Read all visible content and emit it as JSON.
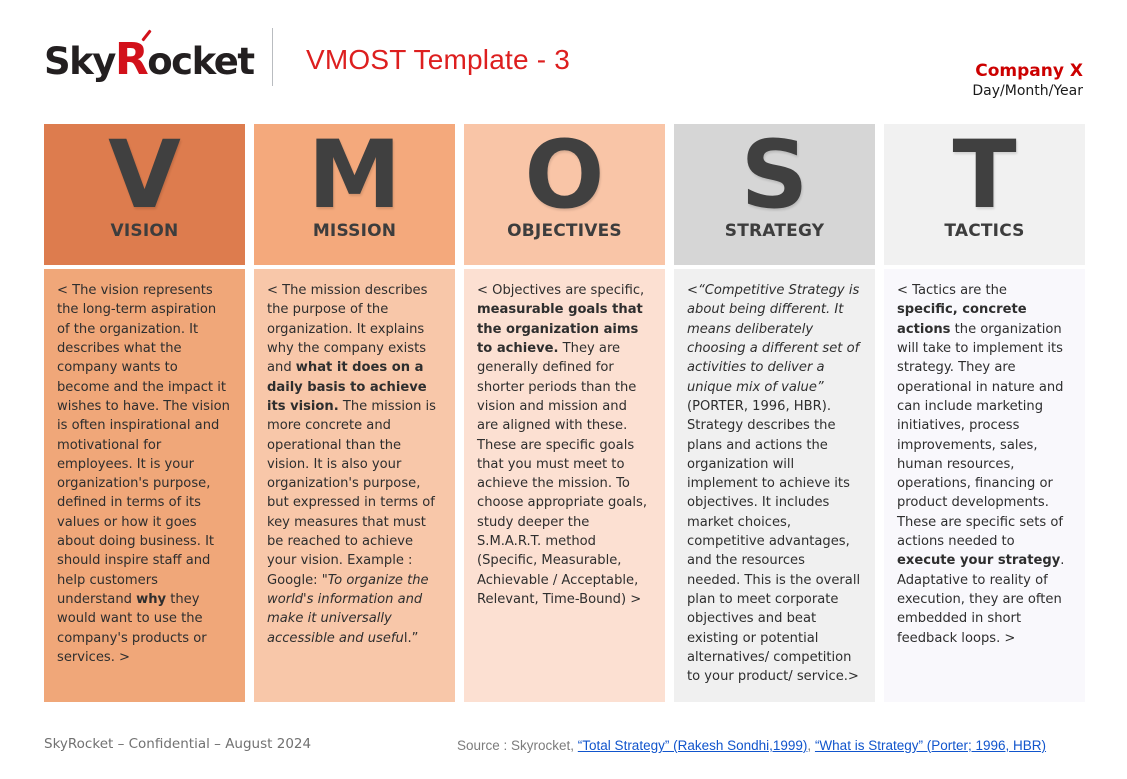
{
  "header": {
    "logo": {
      "part1": "Sky",
      "accent_letter": "R",
      "part2": "ocket",
      "icon": "accent-mark-icon"
    },
    "title": "VMOST Template - 3",
    "company": "Company X",
    "date": "Day/Month/Year",
    "brand_red": "#d2111b",
    "title_red": "#dd1f1f",
    "company_red": "#cc0000"
  },
  "columns": [
    {
      "letter": "V",
      "name": "VISION",
      "head_bg": "#dd7c4e",
      "body_bg": "#f0a779",
      "body_html": "&lt; The vision represents the long-term aspiration of the organization. It describes what the company wants to become and the impact it wishes to have. The vision is often inspirational and motivational for employees. It is your organization's purpose, defined in terms of its values or how it goes about doing business. It should inspire staff and help customers understand <b>why</b> they would want to use the company's products or services. &gt;",
      "body_text": "< The vision represents the long-term aspiration of the organization. It describes what the company wants to become and the impact it wishes to have. The vision is often inspirational and motivational for employees. It is your organization's purpose, defined in terms of its values or how it goes about doing business. It should inspire staff and help customers understand why they would want to use the company's products or services. >"
    },
    {
      "letter": "M",
      "name": "MISSION",
      "head_bg": "#f4a97c",
      "body_bg": "#f8c7a9",
      "body_html": "&lt; The mission describes the purpose of the organization. It explains why the company exists and <b>what it does on a daily basis to achieve its vision.</b> The mission is more concrete and operational than the vision. It is also your organization's purpose, but expressed in terms of key measures that must be reached to achieve your vision. Example : Google: \"<i>To organize the world's information and make it universally accessible and usefu</i>l.”",
      "body_text": "< The mission describes the purpose of the organization. It explains why the company exists and what it does on a daily basis to achieve its vision. The mission is more concrete and operational than the vision. It is also your organization's purpose, but expressed in terms of key measures that must be reached to achieve your vision. Example : Google: \"To organize the world's information and make it universally accessible and useful.”"
    },
    {
      "letter": "O",
      "name": "OBJECTIVES",
      "head_bg": "#f9c5a7",
      "body_bg": "#fce0d2",
      "body_html": "&lt; Objectives are specific, <b>measurable goals that the organization aims to achieve.</b> They are generally defined for shorter periods than the vision and mission and are aligned with these. These are specific goals that you must meet to achieve the mission. To choose appropriate goals, study deeper the S.M.A.R.T. method (Specific, Measurable, Achievable / Acceptable, Relevant, Time-Bound) &gt;",
      "body_text": "< Objectives are specific, measurable goals that the organization aims to achieve. They are generally defined for shorter periods than the vision and mission and are aligned with these. These are specific goals that you must meet to achieve the mission. To choose appropriate goals, study deeper the S.M.A.R.T. method (Specific, Measurable, Achievable / Acceptable, Relevant, Time-Bound) >"
    },
    {
      "letter": "S",
      "name": "STRATEGY",
      "head_bg": "#d6d6d6",
      "body_bg": "#f0f0f0",
      "body_html": "&lt;<i>“Competitive Strategy is about being different. It means deliberately choosing a different set of activities to deliver a unique mix of value”</i> (PORTER, 1996, HBR). Strategy describes the plans and actions the organization will implement to achieve its objectives. It includes market choices, competitive advantages, and the resources needed. This is the overall plan to meet corporate objectives and beat existing or potential alternatives/ competition to your product/ service.&gt;",
      "body_text": "<“Competitive Strategy is about being different. It means deliberately choosing a different set of activities to deliver a unique mix of value” (PORTER, 1996, HBR). Strategy describes the plans and actions the organization will implement to achieve its objectives. It includes market choices, competitive advantages, and the resources needed. This is the overall plan to meet corporate objectives and beat existing or potential alternatives/ competition to your product/ service.>"
    },
    {
      "letter": "T",
      "name": "TACTICS",
      "head_bg": "#f1f1f1",
      "body_bg": "#f9f8fc",
      "body_html": "&lt; Tactics are the <b>specific, concrete actions</b> the organization will take to implement its strategy. They are operational in nature and can include marketing initiatives, process improvements, sales, human resources, operations, financing or product developments. These are specific sets of actions needed to <b>execute your strategy</b>. Adaptative to reality of execution, they are often embedded in short feedback loops. &gt;",
      "body_text": "< Tactics are the specific, concrete actions the organization will take to implement its strategy. They are operational in nature and can include marketing initiatives, process improvements, sales, human resources, operations, financing or product developments. These are specific sets of actions needed to execute your strategy. Adaptative to reality of execution, they are often embedded in short feedback loops. >"
    }
  ],
  "footer": {
    "confidential": "SkyRocket – Confidential – August 2024",
    "source_prefix": "Source : Skyrocket, ",
    "links": [
      {
        "label": "“Total Strategy” (Rakesh Sondhi,1999)",
        "color": "#1155cc"
      },
      {
        "label": "“What is Strategy” (Porter; 1996, HBR)",
        "color": "#1155cc"
      }
    ],
    "link_separator": ", "
  }
}
